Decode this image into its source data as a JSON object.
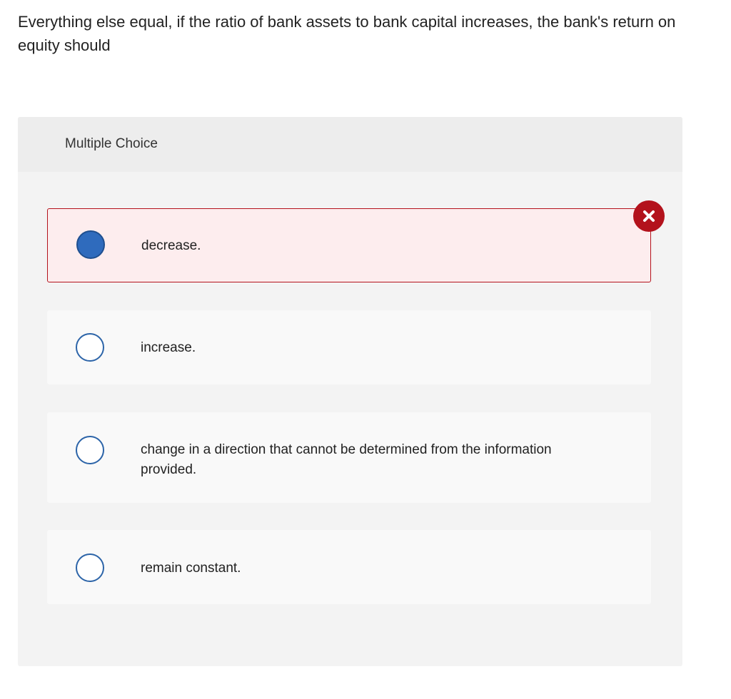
{
  "question": {
    "text": "Everything else equal, if the ratio of bank assets to bank capital increases, the bank's return on equity should"
  },
  "panel": {
    "title": "Multiple Choice"
  },
  "options": [
    {
      "label": "decrease.",
      "selected": true,
      "status": "incorrect"
    },
    {
      "label": "increase.",
      "selected": false
    },
    {
      "label": "change in a direction that cannot be determined from the information provided.",
      "selected": false
    },
    {
      "label": "remain constant.",
      "selected": false
    }
  ],
  "icons": {
    "incorrect": "close-icon"
  },
  "colors": {
    "accent": "#2f6bbd",
    "error": "#b3121c",
    "error_bg": "#fdedee"
  }
}
